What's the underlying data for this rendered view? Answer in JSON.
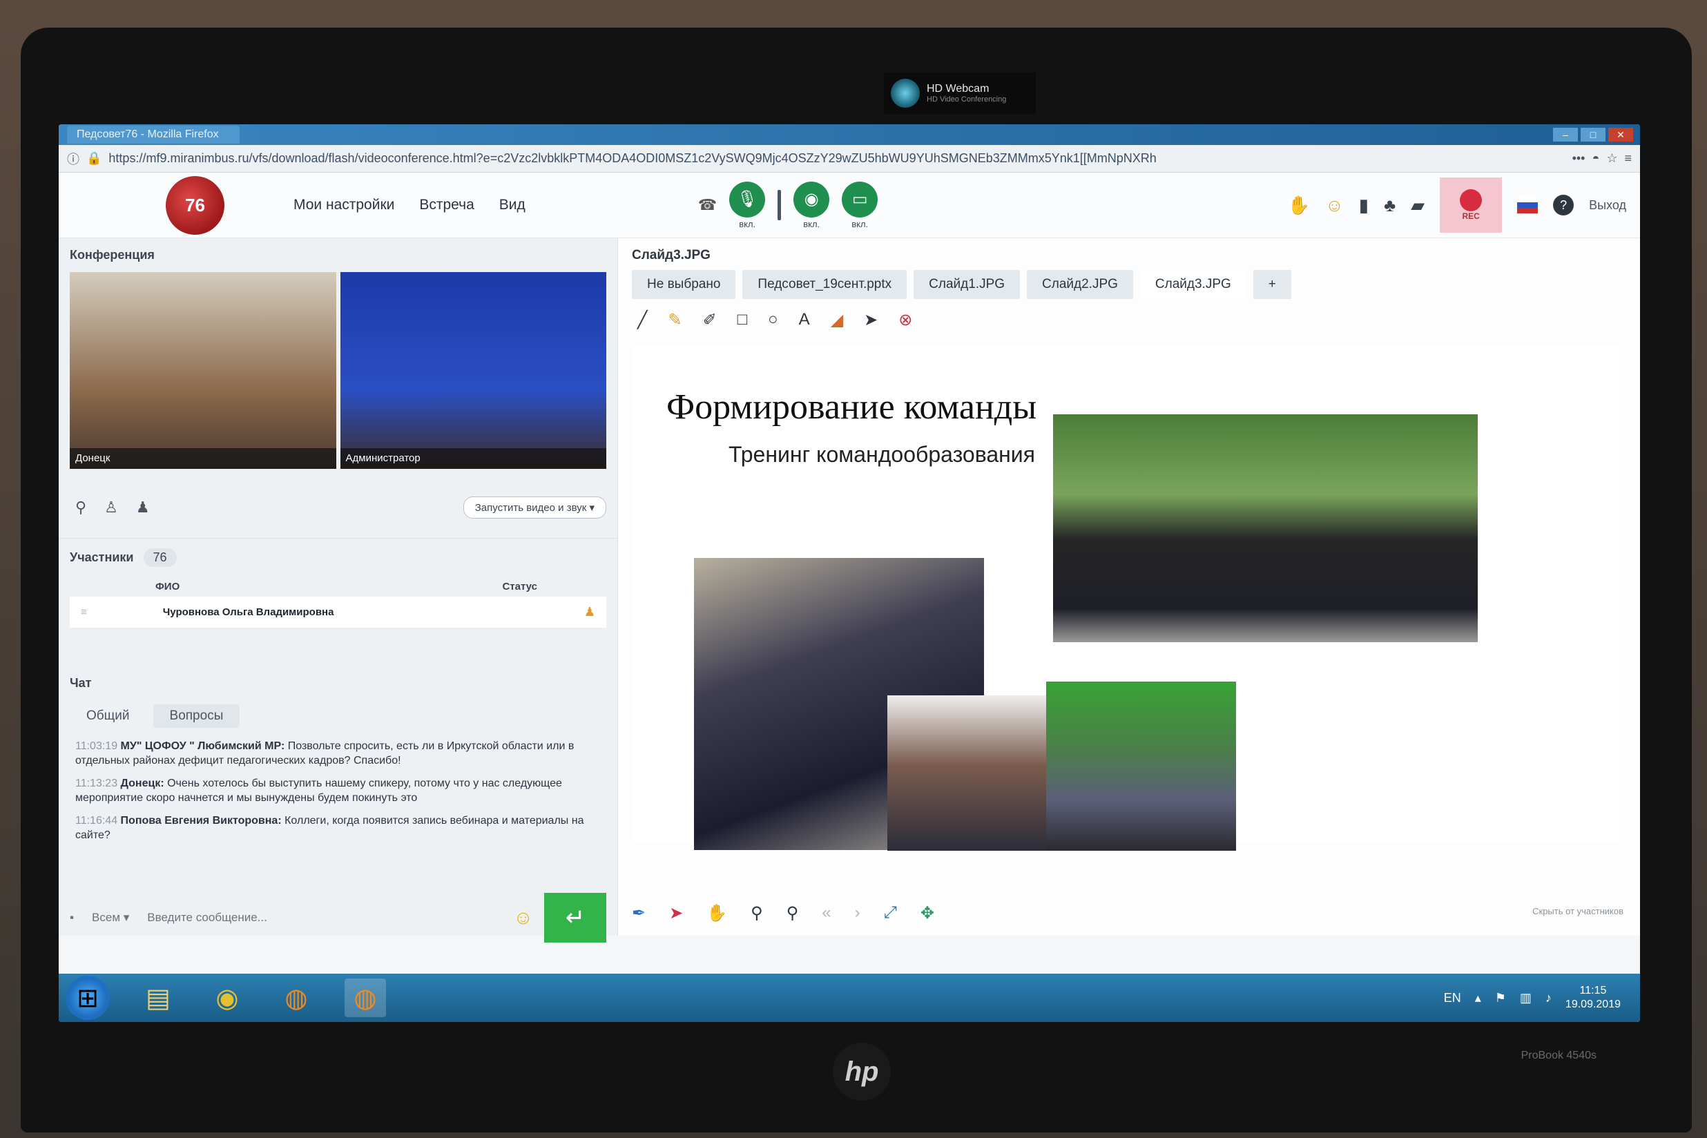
{
  "device": {
    "webcam_title": "HD Webcam",
    "webcam_sub": "HD Video Conferencing",
    "brand": "hp",
    "model": "ProBook 4540s"
  },
  "browser": {
    "tab_title": "Педсовет76 - Mozilla Firefox",
    "url": "https://mf9.miranimbus.ru/vfs/download/flash/videoconference.html?e=c2Vzc2lvbklkPTM4ODA4ODI0MSZ1c2VySWQ9Mjc4OSZzY29wZU5hbWU9YUhSMGNEb3ZMMmx5Ynk1[[MmNpNXRh"
  },
  "app": {
    "menu": [
      "Мои настройки",
      "Встреча",
      "Вид"
    ],
    "media_label": "вкл.",
    "rec_label": "REC",
    "exit_label": "Выход"
  },
  "conference": {
    "title": "Конференция",
    "videos": [
      {
        "label": "Донецк"
      },
      {
        "label": "Администратор"
      }
    ],
    "start_av": "Запустить видео и звук"
  },
  "participants": {
    "title": "Участники",
    "count": "76",
    "col_name": "ФИО",
    "col_status": "Статус",
    "rows": [
      {
        "name": "Чуровнова Ольга Владимировна"
      }
    ]
  },
  "chat": {
    "title": "Чат",
    "tabs": [
      "Общий",
      "Вопросы"
    ],
    "messages": [
      {
        "time": "11:03:19",
        "author": "МУ\" ЦОФОУ \" Любимский МР:",
        "text": "Позвольте спросить, есть ли в Иркутской области или в отдельных районах дефицит педагогических кадров? Спасибо!"
      },
      {
        "time": "11:13:23",
        "author": "Донецк:",
        "text": "Очень хотелось бы выступить нашему спикеру, потому что у нас следующее мероприятие скоро начнется и мы вынуждены будем покинуть это"
      },
      {
        "time": "11:16:44",
        "author": "Попова Евгения  Викторовна:",
        "text": "Коллеги, когда появится запись вебинара и материалы на сайте?"
      }
    ],
    "recipient": "Всем",
    "placeholder": "Введите сообщение..."
  },
  "presentation": {
    "current_file": "Слайд3.JPG",
    "tabs": [
      "Не выбрано",
      "Педсовет_19сент.pptx",
      "Слайд1.JPG",
      "Слайд2.JPG",
      "Слайд3.JPG",
      "+"
    ],
    "slide_title": "Формирование команды",
    "slide_subtitle": "Тренинг командообразования",
    "hide_label": "Скрыть от участников"
  },
  "taskbar": {
    "lang": "EN",
    "time": "11:15",
    "date": "19.09.2019"
  }
}
